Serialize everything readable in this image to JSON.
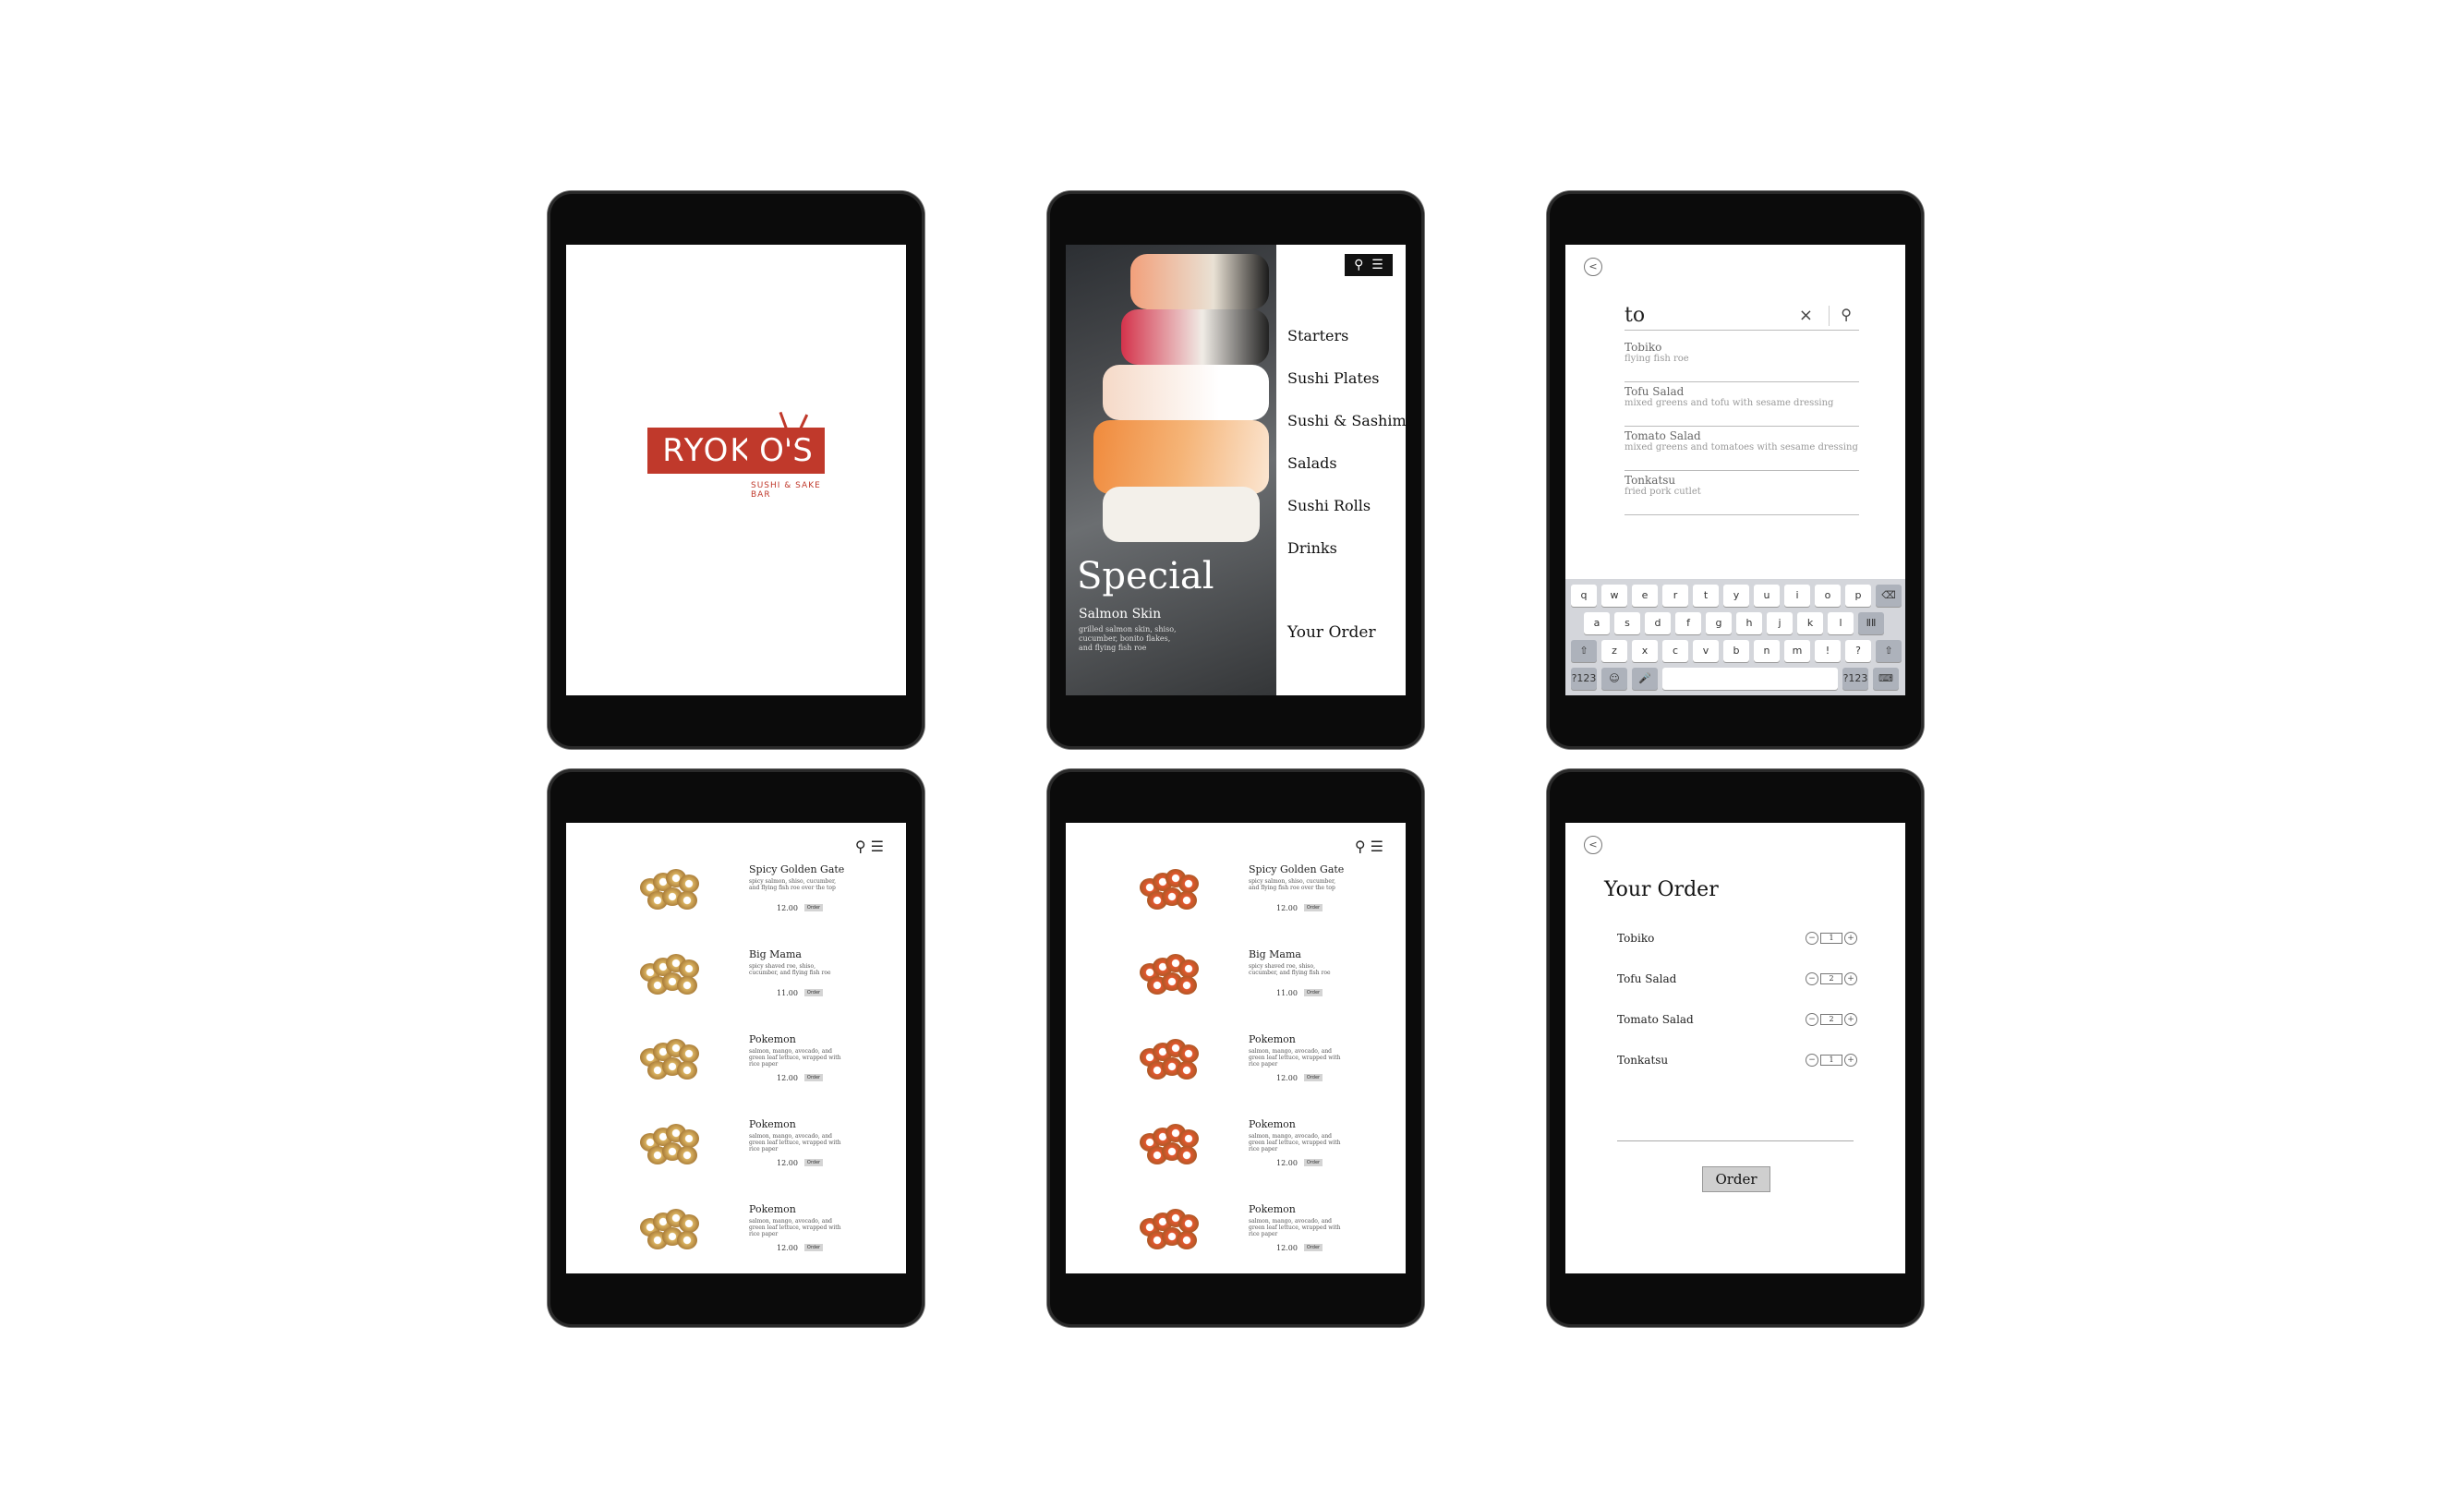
{
  "splash": {
    "brand": "RYOK",
    "brand_tail": "O'S",
    "tagline": "SUSHI & SAKE BAR",
    "brand_color": "#c0392b"
  },
  "menu_screen": {
    "nav_items": [
      "Starters",
      "Sushi Plates",
      "Sushi & Sashimi",
      "Salads",
      "Sushi Rolls",
      "Drinks"
    ],
    "your_order": "Your Order",
    "special_title": "Special",
    "special_item": "Salmon Skin",
    "special_desc": "grilled salmon skin, shiso, cucumber, bonito flakes, and flying fish roe",
    "icons": [
      "search-icon",
      "hamburger-menu-icon"
    ]
  },
  "search_screen": {
    "query": "to",
    "suggestions": [
      {
        "name": "Tobiko",
        "desc": "flying fish roe"
      },
      {
        "name": "Tofu Salad",
        "desc": "mixed greens and tofu with sesame dressing"
      },
      {
        "name": "Tomato Salad",
        "desc": "mixed greens and tomatoes with sesame dressing"
      },
      {
        "name": "Tonkatsu",
        "desc": "fried pork cutlet"
      }
    ],
    "keyboard": {
      "row1": [
        "q",
        "w",
        "e",
        "r",
        "t",
        "y",
        "u",
        "i",
        "o",
        "p",
        "⌫"
      ],
      "row2": [
        "a",
        "s",
        "d",
        "f",
        "g",
        "h",
        "j",
        "k",
        "l",
        "ⅡⅡ"
      ],
      "row3": [
        "⇧",
        "z",
        "x",
        "c",
        "v",
        "b",
        "n",
        "m",
        "!",
        "?",
        "⇧"
      ],
      "row4": [
        "?123",
        "☺",
        "🎤",
        "",
        "?123",
        "⌨"
      ]
    }
  },
  "list_yellow": {
    "products": [
      {
        "name": "Spicy Golden Gate",
        "desc": "spicy salmon, shiso, cucumber, and flying fish roe over the top",
        "price": "12.00",
        "btn": "Order"
      },
      {
        "name": "Big Mama",
        "desc": "spicy shaved roe, shiso, cucumber, and flying fish roe",
        "price": "11.00",
        "btn": "Order"
      },
      {
        "name": "Pokemon",
        "desc": "salmon, mango, avocado, and green leaf lettuce, wrapped with rice paper",
        "price": "12.00",
        "btn": "Order"
      },
      {
        "name": "Pokemon",
        "desc": "salmon, mango, avocado, and green leaf lettuce, wrapped with rice paper",
        "price": "12.00",
        "btn": "Order"
      },
      {
        "name": "Pokemon",
        "desc": "salmon, mango, avocado, and green leaf lettuce, wrapped with rice paper",
        "price": "12.00",
        "btn": "Order"
      }
    ],
    "roll_color": "#d9b15f"
  },
  "list_orange": {
    "products": [
      {
        "name": "Spicy Golden Gate",
        "desc": "spicy salmon, shiso, cucumber, and flying fish roe over the top",
        "price": "12.00",
        "btn": "Order"
      },
      {
        "name": "Big Mama",
        "desc": "spicy shaved roe, shiso, cucumber, and flying fish roe",
        "price": "11.00",
        "btn": "Order"
      },
      {
        "name": "Pokemon",
        "desc": "salmon, mango, avocado, and green leaf lettuce, wrapped with rice paper",
        "price": "12.00",
        "btn": "Order"
      },
      {
        "name": "Pokemon",
        "desc": "salmon, mango, avocado, and green leaf lettuce, wrapped with rice paper",
        "price": "12.00",
        "btn": "Order"
      },
      {
        "name": "Pokemon",
        "desc": "salmon, mango, avocado, and green leaf lettuce, wrapped with rice paper",
        "price": "12.00",
        "btn": "Order"
      }
    ],
    "roll_color": "#e2572e"
  },
  "order_screen": {
    "title": "Your Order",
    "items": [
      {
        "name": "Tobiko",
        "qty": "1"
      },
      {
        "name": "Tofu Salad",
        "qty": "2"
      },
      {
        "name": "Tomato Salad",
        "qty": "2"
      },
      {
        "name": "Tonkatsu",
        "qty": "1"
      }
    ],
    "button": "Order"
  }
}
